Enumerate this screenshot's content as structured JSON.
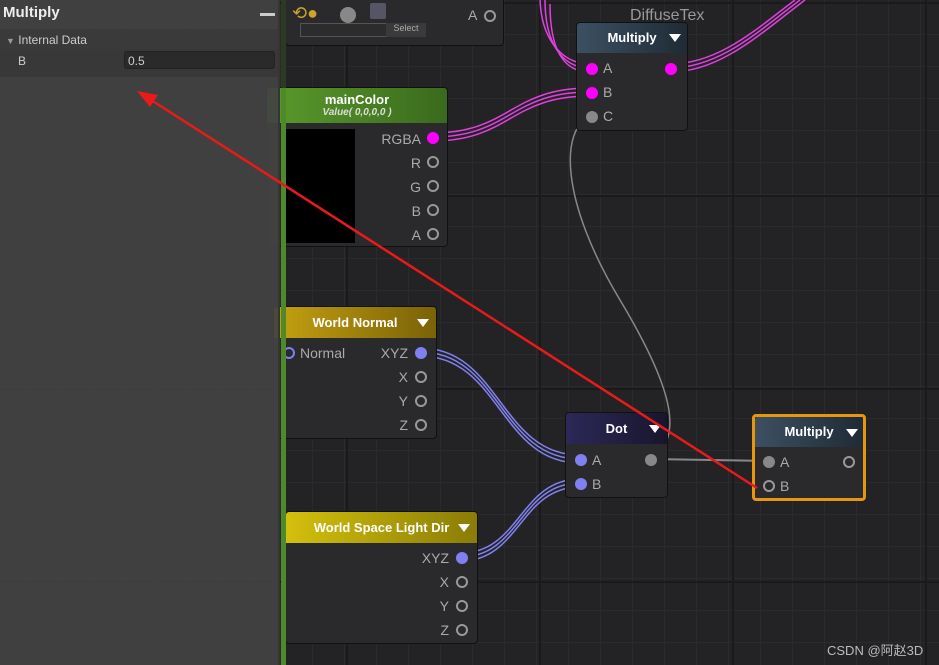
{
  "inspector": {
    "title": "Multiply",
    "collapse_icon": "minus-icon",
    "section": "Internal Data",
    "field_label": "B",
    "field_value": "0.5"
  },
  "canvas": {
    "label": "DiffuseTex",
    "watermark": "CSDN @阿赵3D"
  },
  "top_node": {
    "select_label": "Select",
    "port": "A"
  },
  "multiply_top": {
    "title": "Multiply",
    "inputs": [
      "A",
      "B",
      "C"
    ]
  },
  "main_color": {
    "title": "mainColor",
    "subtitle": "Value( 0,0,0,0 )",
    "outputs": [
      "RGBA",
      "R",
      "G",
      "B",
      "A"
    ]
  },
  "world_normal": {
    "title": "World Normal",
    "input": "Normal",
    "outputs": [
      "XYZ",
      "X",
      "Y",
      "Z"
    ]
  },
  "light_dir": {
    "title": "World Space Light Dir",
    "outputs": [
      "XYZ",
      "X",
      "Y",
      "Z"
    ]
  },
  "dot_node": {
    "title": "Dot",
    "inputs": [
      "A",
      "B"
    ]
  },
  "multiply_selected": {
    "title": "Multiply",
    "inputs": [
      "A",
      "B"
    ]
  },
  "colors": {
    "magenta": "#ff00ff",
    "blue": "#7b7bef",
    "selected": "#e8960e",
    "arrow": "#e81a1a",
    "green": "#4e8a2a"
  }
}
